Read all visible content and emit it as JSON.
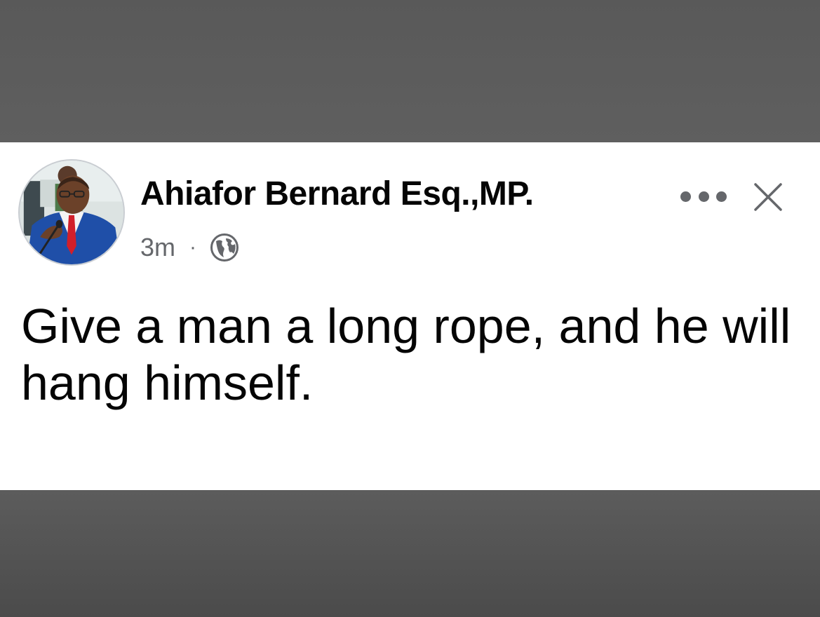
{
  "post": {
    "author_name": "Ahiafor Bernard Esq.,MP.",
    "timestamp": "3m",
    "separator": "·",
    "audience_icon": "globe-icon",
    "text": "Give a man a long rope, and he will hang himself.",
    "actions": {
      "more_icon": "more-options-icon",
      "close_icon": "close-icon"
    }
  },
  "colors": {
    "background": "#5a5a5a",
    "card": "#ffffff",
    "text": "#050505",
    "secondary_text": "#65676b"
  }
}
